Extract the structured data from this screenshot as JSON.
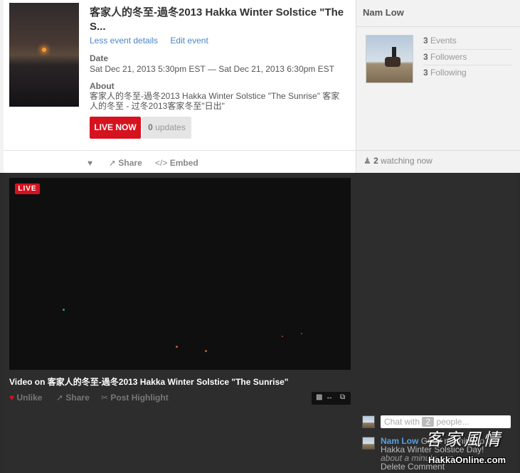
{
  "event": {
    "title": "客家人的冬至-過冬2013 Hakka Winter Solstice \"The S...",
    "less_details": "Less event details",
    "edit_event": "Edit event",
    "date_label": "Date",
    "date_value": "Sat Dec 21, 2013 5:30pm EST — Sat Dec 21, 2013 6:30pm EST",
    "about_label": "About",
    "about_text": "客家人的冬至-過冬2013 Hakka Winter Solstice \"The Sunrise\" 客家人的冬至 - 过冬2013客家冬至\"日出\"",
    "live_now": "LIVE NOW",
    "updates_count": "0",
    "updates_label": "updates"
  },
  "actions": {
    "share": "Share",
    "embed": "Embed"
  },
  "owner": {
    "name": "Nam Low",
    "events_count": "3",
    "events_label": "Events",
    "followers_count": "3",
    "followers_label": "Followers",
    "following_count": "3",
    "following_label": "Following",
    "watching_count": "2",
    "watching_label": "watching now"
  },
  "video": {
    "live_tag": "LIVE",
    "caption": "Video on 客家人的冬至-過冬2013 Hakka Winter Solstice \"The Sunrise\"",
    "unlike": "Unlike",
    "share": "Share",
    "post_highlight": "Post Highlight"
  },
  "chat": {
    "placeholder_prefix": "Chat with",
    "people_count": "2",
    "placeholder_suffix": "people...",
    "msg_name": "Nam Low",
    "msg_text": "Good morning to the Hakka Winter Solstice Day!",
    "msg_time": "about a minute ago",
    "delete": "Delete Comment"
  },
  "watermark": {
    "chars": "客家風情",
    "site": "HakkaOnline.com"
  }
}
